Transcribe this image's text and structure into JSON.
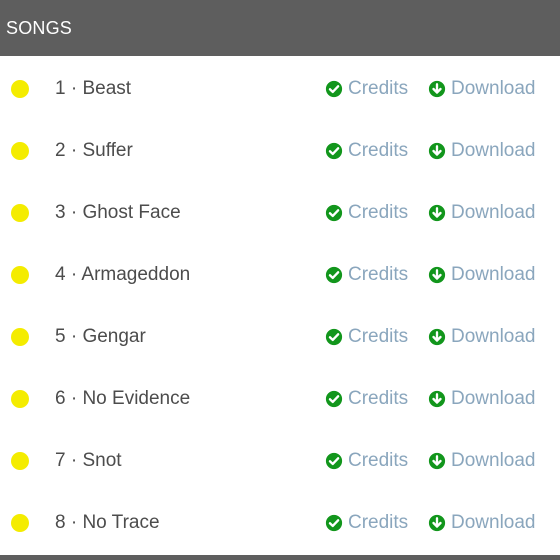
{
  "header": {
    "title": "SONGS"
  },
  "colors": {
    "header_bg": "#5e5e5e",
    "status_dot": "#f4ec00",
    "icon_green": "#12961c",
    "link_text": "#8aa6bd"
  },
  "actions": {
    "credits_label": "Credits",
    "download_label": "Download",
    "credits_icon": "check-circle-icon",
    "download_icon": "download-circle-icon"
  },
  "songs": [
    {
      "label": "1 · Beast"
    },
    {
      "label": "2 · Suffer"
    },
    {
      "label": "3 · Ghost Face"
    },
    {
      "label": "4 · Armageddon"
    },
    {
      "label": "5 · Gengar"
    },
    {
      "label": "6 · No Evidence"
    },
    {
      "label": "7 · Snot"
    },
    {
      "label": "8 · No Trace"
    }
  ]
}
